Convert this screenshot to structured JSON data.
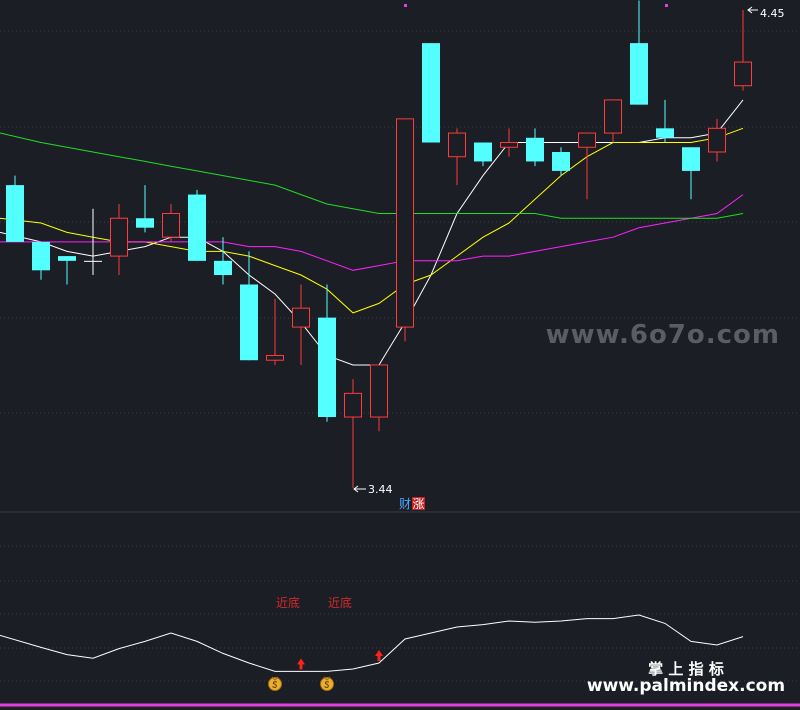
{
  "chart_data": {
    "type": "candlestick",
    "title": "",
    "colors": {
      "up": "#ff3b3b",
      "down": "#54ffff",
      "ma5": "#ffffff",
      "ma10": "#ffff00",
      "ma30": "#ff22ff",
      "ma60": "#22dd22",
      "oscillator": "#ffffff",
      "signal": "#d42a2a",
      "bottom_line": "#e040e0",
      "grid": "#3a3d46"
    },
    "candles": [
      {
        "o": 4.08,
        "h": 4.1,
        "l": 3.96,
        "c": 3.96
      },
      {
        "o": 3.96,
        "h": 3.96,
        "l": 3.88,
        "c": 3.9
      },
      {
        "o": 3.93,
        "h": 3.93,
        "l": 3.87,
        "c": 3.92
      },
      {
        "o": 3.92,
        "h": 4.03,
        "l": 3.89,
        "c": 3.92
      },
      {
        "o": 3.93,
        "h": 4.04,
        "l": 3.89,
        "c": 4.01
      },
      {
        "o": 4.01,
        "h": 4.08,
        "l": 3.98,
        "c": 3.99
      },
      {
        "o": 3.97,
        "h": 4.04,
        "l": 3.96,
        "c": 4.02
      },
      {
        "o": 4.06,
        "h": 4.07,
        "l": 3.92,
        "c": 3.92
      },
      {
        "o": 3.92,
        "h": 3.97,
        "l": 3.87,
        "c": 3.89
      },
      {
        "o": 3.87,
        "h": 3.94,
        "l": 3.71,
        "c": 3.71
      },
      {
        "o": 3.71,
        "h": 3.84,
        "l": 3.7,
        "c": 3.72
      },
      {
        "o": 3.78,
        "h": 3.87,
        "l": 3.7,
        "c": 3.82
      },
      {
        "o": 3.8,
        "h": 3.87,
        "l": 3.58,
        "c": 3.59
      },
      {
        "o": 3.59,
        "h": 3.67,
        "l": 3.44,
        "c": 3.64
      },
      {
        "o": 3.59,
        "h": 3.7,
        "l": 3.56,
        "c": 3.7
      },
      {
        "o": 3.78,
        "h": 4.22,
        "l": 3.75,
        "c": 4.22
      },
      {
        "o": 4.38,
        "h": 4.38,
        "l": 4.18,
        "c": 4.17
      },
      {
        "o": 4.14,
        "h": 4.2,
        "l": 4.08,
        "c": 4.19
      },
      {
        "o": 4.17,
        "h": 4.17,
        "l": 4.12,
        "c": 4.13
      },
      {
        "o": 4.16,
        "h": 4.2,
        "l": 4.14,
        "c": 4.17
      },
      {
        "o": 4.18,
        "h": 4.2,
        "l": 4.12,
        "c": 4.13
      },
      {
        "o": 4.15,
        "h": 4.16,
        "l": 4.1,
        "c": 4.11
      },
      {
        "o": 4.16,
        "h": 4.19,
        "l": 4.05,
        "c": 4.19
      },
      {
        "o": 4.19,
        "h": 4.26,
        "l": 4.17,
        "c": 4.26
      },
      {
        "o": 4.38,
        "h": 4.47,
        "l": 4.25,
        "c": 4.25
      },
      {
        "o": 4.2,
        "h": 4.26,
        "l": 4.17,
        "c": 4.18
      },
      {
        "o": 4.16,
        "h": 4.16,
        "l": 4.05,
        "c": 4.11
      },
      {
        "o": 4.15,
        "h": 4.22,
        "l": 4.13,
        "c": 4.2
      },
      {
        "o": 4.29,
        "h": 4.45,
        "l": 4.28,
        "c": 4.34
      }
    ],
    "ma": [
      {
        "name": "MA5",
        "values": [
          3.98,
          3.96,
          3.94,
          3.93,
          3.94,
          3.95,
          3.97,
          3.97,
          3.94,
          3.89,
          3.85,
          3.79,
          3.72,
          3.7,
          3.7,
          3.79,
          3.89,
          4.02,
          4.1,
          4.17,
          4.17,
          4.17,
          4.17,
          4.17,
          4.17,
          4.18,
          4.18,
          4.19,
          4.26
        ]
      },
      {
        "name": "MA10",
        "values": [
          4.01,
          4.0,
          3.98,
          3.97,
          3.96,
          3.96,
          3.95,
          3.94,
          3.94,
          3.93,
          3.91,
          3.89,
          3.86,
          3.81,
          3.83,
          3.87,
          3.89,
          3.93,
          3.97,
          4.0,
          4.05,
          4.1,
          4.14,
          4.17,
          4.17,
          4.17,
          4.17,
          4.18,
          4.2
        ]
      },
      {
        "name": "MA30",
        "values": [
          3.96,
          3.96,
          3.96,
          3.96,
          3.96,
          3.96,
          3.96,
          3.96,
          3.96,
          3.95,
          3.95,
          3.94,
          3.92,
          3.9,
          3.91,
          3.92,
          3.92,
          3.92,
          3.93,
          3.93,
          3.94,
          3.95,
          3.96,
          3.97,
          3.99,
          4.0,
          4.01,
          4.02,
          4.06
        ]
      },
      {
        "name": "MA60",
        "values": [
          4.19,
          4.17,
          4.16,
          4.15,
          4.14,
          4.13,
          4.12,
          4.11,
          4.1,
          4.09,
          4.08,
          4.06,
          4.04,
          4.03,
          4.02,
          4.02,
          4.02,
          4.02,
          4.02,
          4.02,
          4.02,
          4.01,
          4.01,
          4.01,
          4.01,
          4.01,
          4.01,
          4.01,
          4.02
        ]
      }
    ],
    "oscillator": [
      58,
      48,
      42,
      39,
      47,
      53,
      60,
      53,
      43,
      35,
      28,
      28,
      28,
      30,
      35,
      55,
      60,
      65,
      67,
      70,
      69,
      70,
      72,
      72,
      75,
      68,
      53,
      50,
      57
    ],
    "annotations": {
      "max_label": "4.45",
      "min_label": "3.44",
      "near_bottom_1": "近底",
      "near_bottom_2": "近底",
      "badge_cai": "财",
      "badge_zhang": "涨"
    },
    "watermark": "www.6o7o.com",
    "footer_brand": "掌 上 指 标",
    "footer_url": "www.palmindex.com"
  }
}
